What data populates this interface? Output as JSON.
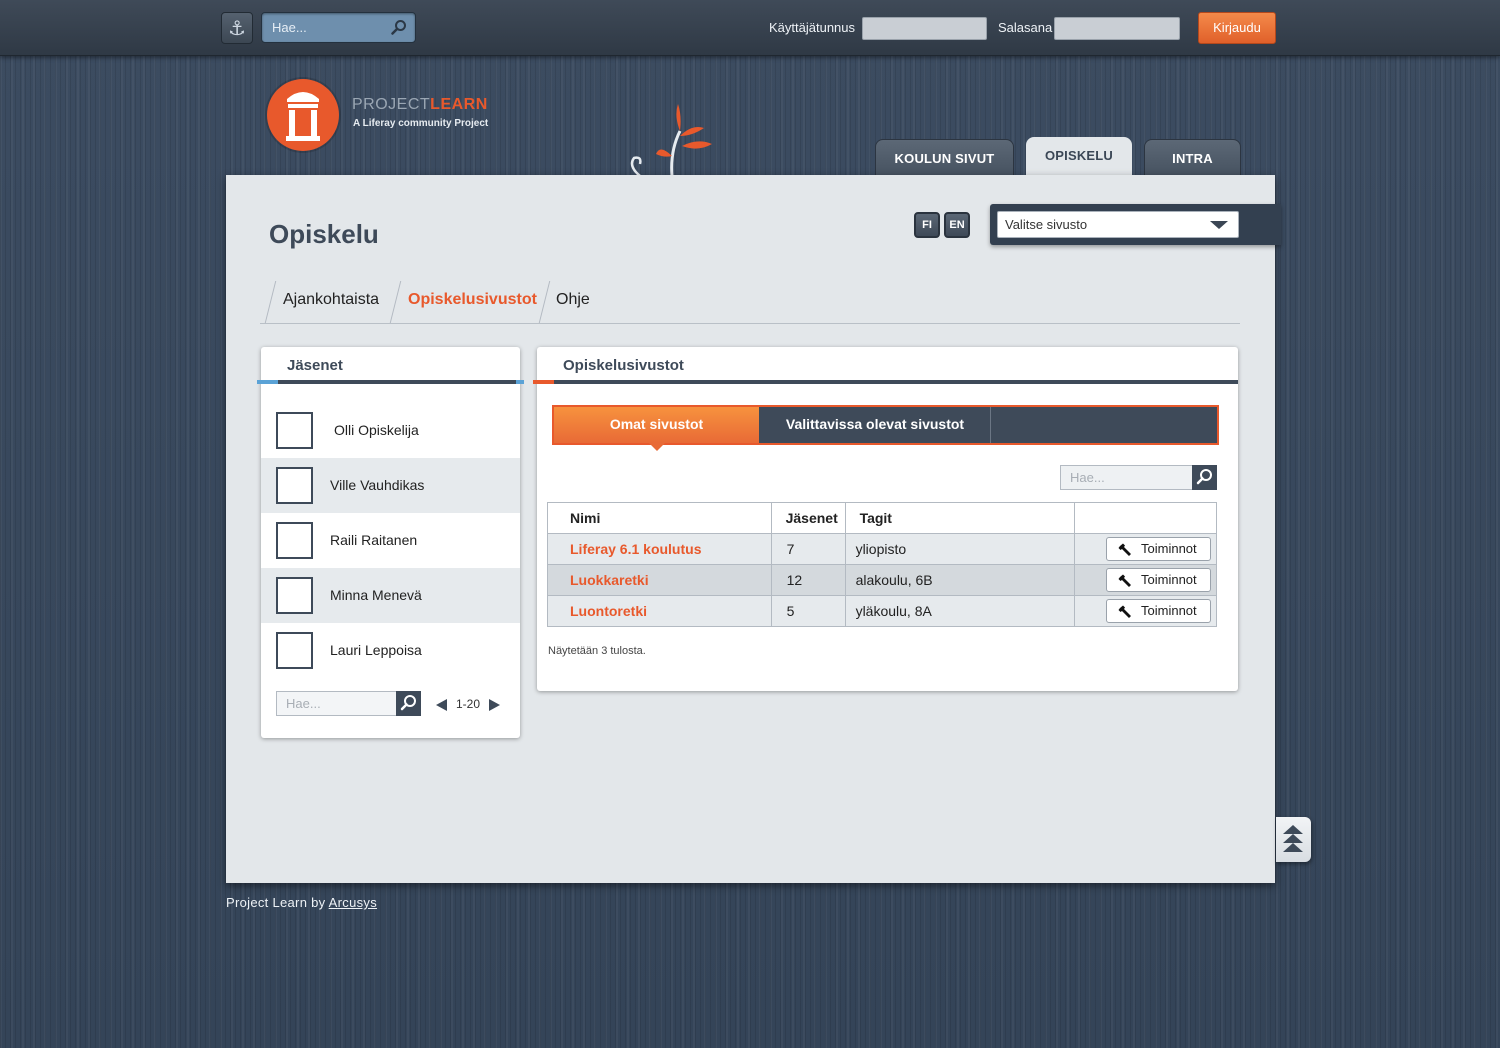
{
  "topbar": {
    "search_placeholder": "Hae...",
    "username_label": "Käyttäjätunnus",
    "password_label": "Salasana",
    "login_label": "Kirjaudu"
  },
  "logo": {
    "name_part1": "PROJECT",
    "name_part2": "LEARN",
    "tagline": "A Liferay community Project"
  },
  "nav": {
    "tabs": [
      {
        "label": "KOULUN SIVUT",
        "active": false
      },
      {
        "label": "OPISKELU",
        "active": true
      },
      {
        "label": "INTRA",
        "active": false
      }
    ]
  },
  "page": {
    "title": "Opiskelu",
    "languages": [
      "FI",
      "EN"
    ],
    "site_select": "Valitse sivusto",
    "subtabs": [
      {
        "label": "Ajankohtaista",
        "active": false
      },
      {
        "label": "Opiskelusivustot",
        "active": true
      },
      {
        "label": "Ohje",
        "active": false
      }
    ]
  },
  "members": {
    "title": "Jäsenet",
    "items": [
      {
        "name": "Olli Opiskelija"
      },
      {
        "name": "Ville Vauhdikas"
      },
      {
        "name": "Raili Raitanen"
      },
      {
        "name": "Minna Menevä"
      },
      {
        "name": "Lauri Leppoisa"
      }
    ],
    "search_placeholder": "Hae...",
    "pager": "1-20"
  },
  "sites": {
    "title": "Opiskelusivustot",
    "seg_tabs": [
      {
        "label": "Omat sivustot",
        "active": true
      },
      {
        "label": "Valittavissa olevat sivustot",
        "active": false
      }
    ],
    "search_placeholder": "Hae...",
    "columns": [
      "Nimi",
      "Jäsenet",
      "Tagit",
      ""
    ],
    "rows": [
      {
        "name": "Liferay 6.1 koulutus",
        "members": "7",
        "tags": "yliopisto",
        "action": "Toiminnot"
      },
      {
        "name": "Luokkaretki",
        "members": "12",
        "tags": "alakoulu, 6B",
        "action": "Toiminnot"
      },
      {
        "name": "Luontoretki",
        "members": "5",
        "tags": "yläkoulu, 8A",
        "action": "Toiminnot"
      }
    ],
    "results_text": "Näytetään 3 tulosta."
  },
  "footer": {
    "text": "Project Learn by",
    "link": "Arcusys"
  },
  "colors": {
    "accent": "#e8592c",
    "dark": "#3e4a59",
    "panel": "#e3e7ea"
  }
}
